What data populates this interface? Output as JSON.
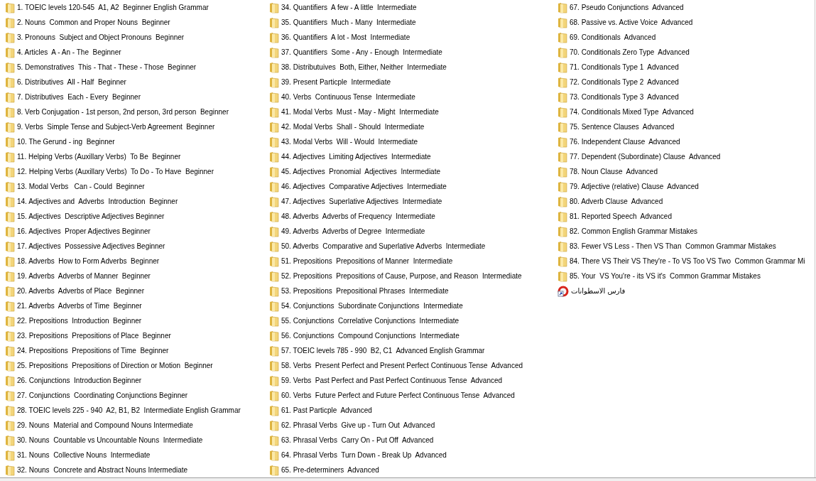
{
  "items": [
    {
      "kind": "folder",
      "label": "1. TOEIC levels 120-545  A1, A2  Beginner English Grammar"
    },
    {
      "kind": "folder",
      "label": "2. Nouns  Common and Proper Nouns  Beginner"
    },
    {
      "kind": "folder",
      "label": "3. Pronouns  Subject and Object Pronouns  Beginner"
    },
    {
      "kind": "folder",
      "label": "4. Articles  A - An - The  Beginner"
    },
    {
      "kind": "folder",
      "label": "5. Demonstratives  This - That - These - Those  Beginner"
    },
    {
      "kind": "folder",
      "label": "6. Distributives  All - Half  Beginner"
    },
    {
      "kind": "folder",
      "label": "7. Distributives  Each - Every  Beginner"
    },
    {
      "kind": "folder",
      "label": "8. Verb Conjugation - 1st person, 2nd person, 3rd person  Beginner"
    },
    {
      "kind": "folder",
      "label": "9. Verbs  Simple Tense and Subject-Verb Agreement  Beginner"
    },
    {
      "kind": "folder",
      "label": "10. The Gerund - ing  Beginner"
    },
    {
      "kind": "folder",
      "label": "11. Helping Verbs (Auxillary Verbs)  To Be  Beginner"
    },
    {
      "kind": "folder",
      "label": "12. Helping Verbs (Auxillary Verbs)  To Do - To Have  Beginner"
    },
    {
      "kind": "folder",
      "label": "13. Modal Verbs   Can - Could  Beginner"
    },
    {
      "kind": "folder",
      "label": "14. Adjectives and  Adverbs  Introduction  Beginner"
    },
    {
      "kind": "folder",
      "label": "15. Adjectives  Descriptive Adjectives Beginner"
    },
    {
      "kind": "folder",
      "label": "16. Adjectives  Proper Adjectives Beginner"
    },
    {
      "kind": "folder",
      "label": "17. Adjectives  Possessive Adjectives Beginner"
    },
    {
      "kind": "folder",
      "label": "18. Adverbs  How to Form Adverbs  Beginner"
    },
    {
      "kind": "folder",
      "label": "19. Adverbs  Adverbs of Manner  Beginner"
    },
    {
      "kind": "folder",
      "label": "20. Adverbs  Adverbs of Place  Beginner"
    },
    {
      "kind": "folder",
      "label": "21. Adverbs  Adverbs of Time  Beginner"
    },
    {
      "kind": "folder",
      "label": "22. Prepositions  Introduction  Beginner"
    },
    {
      "kind": "folder",
      "label": "23. Prepositions  Prepositions of Place  Beginner"
    },
    {
      "kind": "folder",
      "label": "24. Prepositions  Prepositions of Time  Beginner"
    },
    {
      "kind": "folder",
      "label": "25. Prepositions  Prepositions of Direction or Motion  Beginner"
    },
    {
      "kind": "folder",
      "label": "26. Conjunctions  Introduction Beginner"
    },
    {
      "kind": "folder",
      "label": "27. Conjunctions  Coordinating Conjunctions Beginner"
    },
    {
      "kind": "folder",
      "label": "28. TOEIC levels 225 - 940  A2, B1, B2  Intermediate English Grammar"
    },
    {
      "kind": "folder",
      "label": "29. Nouns  Material and Compound Nouns Intermediate"
    },
    {
      "kind": "folder",
      "label": "30. Nouns  Countable vs Uncountable Nouns  Intermediate"
    },
    {
      "kind": "folder",
      "label": "31. Nouns  Collective Nouns  Intermediate"
    },
    {
      "kind": "folder",
      "label": "32. Nouns  Concrete and Abstract Nouns Intermediate"
    },
    {
      "kind": "folder",
      "label": "34. Quantifiers  A few - A little  Intermediate"
    },
    {
      "kind": "folder",
      "label": "35. Quantifiers  Much - Many  Intermediate"
    },
    {
      "kind": "folder",
      "label": "36. Quantifiers  A lot - Most  Intermediate"
    },
    {
      "kind": "folder",
      "label": "37. Quantifiers  Some - Any - Enough  Intermediate"
    },
    {
      "kind": "folder",
      "label": "38. Distributuives  Both, Either, Neither  Intermediate"
    },
    {
      "kind": "folder",
      "label": "39. Present Particple  Intermediate"
    },
    {
      "kind": "folder",
      "label": "40. Verbs  Continuous Tense  Intermediate"
    },
    {
      "kind": "folder",
      "label": "41. Modal Verbs  Must - May - Might  Intermediate"
    },
    {
      "kind": "folder",
      "label": "42. Modal Verbs  Shall - Should  Intermediate"
    },
    {
      "kind": "folder",
      "label": "43. Modal Verbs  Will - Would  Intermediate"
    },
    {
      "kind": "folder",
      "label": "44. Adjectives  Limiting Adjectives  Intermediate"
    },
    {
      "kind": "folder",
      "label": "45. Adjectives  Pronomial  Adjectives  Intermediate"
    },
    {
      "kind": "folder",
      "label": "46. Adjectives  Comparative Adjectives  Intermediate"
    },
    {
      "kind": "folder",
      "label": "47. Adjectives  Superlative Adjectives  Intermediate"
    },
    {
      "kind": "folder",
      "label": "48. Adverbs  Adverbs of Frequency  Intermediate"
    },
    {
      "kind": "folder",
      "label": "49. Adverbs  Adverbs of Degree  Intermediate"
    },
    {
      "kind": "folder",
      "label": "50. Adverbs  Comparative and Superlative Adverbs  Intermediate"
    },
    {
      "kind": "folder",
      "label": "51. Prepositions  Prepositions of Manner  Intermediate"
    },
    {
      "kind": "folder",
      "label": "52. Prepositions  Prepositions of Cause, Purpose, and Reason  Intermediate"
    },
    {
      "kind": "folder",
      "label": "53. Prepositions  Prepositional Phrases  Intermediate"
    },
    {
      "kind": "folder",
      "label": "54. Conjunctions  Subordinate Conjunctions  Intermediate"
    },
    {
      "kind": "folder",
      "label": "55. Conjunctions  Correlative Conjunctions  Intermediate"
    },
    {
      "kind": "folder",
      "label": "56. Conjunctions  Compound Conjunctions  Intermediate"
    },
    {
      "kind": "folder",
      "label": "57. TOEIC levels 785 - 990  B2, C1  Advanced English Grammar"
    },
    {
      "kind": "folder",
      "label": "58. Verbs  Present Perfect and Present Perfect Continuous Tense  Advanced"
    },
    {
      "kind": "folder",
      "label": "59. Verbs  Past Perfect and Past Perfect Continuous Tense  Advanced"
    },
    {
      "kind": "folder",
      "label": "60. Verbs  Future Perfect and Future Perfect Continuous Tense  Advanced"
    },
    {
      "kind": "folder",
      "label": "61. Past Particple  Advanced"
    },
    {
      "kind": "folder",
      "label": "62. Phrasal Verbs  Give up - Turn Out  Advanced"
    },
    {
      "kind": "folder",
      "label": "63. Phrasal Verbs  Carry On - Put Off  Advanced"
    },
    {
      "kind": "folder",
      "label": "64. Phrasal Verbs  Turn Down - Break Up  Advanced"
    },
    {
      "kind": "folder",
      "label": "65. Pre-determiners  Advanced"
    },
    {
      "kind": "folder",
      "label": "67. Pseudo Conjunctions  Advanced"
    },
    {
      "kind": "folder",
      "label": "68. Passive vs. Active Voice  Advanced"
    },
    {
      "kind": "folder",
      "label": "69. Conditionals  Advanced"
    },
    {
      "kind": "folder",
      "label": "70. Conditionals Zero Type  Advanced"
    },
    {
      "kind": "folder",
      "label": "71. Conditionals Type 1  Advanced"
    },
    {
      "kind": "folder",
      "label": "72. Conditionals Type 2  Advanced"
    },
    {
      "kind": "folder",
      "label": "73. Conditionals Type 3  Advanced"
    },
    {
      "kind": "folder",
      "label": "74. Conditionals Mixed Type  Advanced"
    },
    {
      "kind": "folder",
      "label": "75. Sentence Clauses  Advanced"
    },
    {
      "kind": "folder",
      "label": "76. Independent Clause  Advanced"
    },
    {
      "kind": "folder",
      "label": "77. Dependent (Subordinate) Clause  Advanced"
    },
    {
      "kind": "folder",
      "label": "78. Noun Clause  Advanced"
    },
    {
      "kind": "folder",
      "label": "79. Adjective (relative) Clause  Advanced"
    },
    {
      "kind": "folder",
      "label": "80. Adverb Clause  Advanced"
    },
    {
      "kind": "folder",
      "label": "81. Reported Speech  Advanced"
    },
    {
      "kind": "folder",
      "label": "82. Common English Grammar Mistakes"
    },
    {
      "kind": "folder",
      "label": "83. Fewer VS Less - Then VS Than  Common Grammar Mistakes"
    },
    {
      "kind": "folder",
      "label": "84. There VS Their VS They're - To VS Too VS Two  Common Grammar Mi"
    },
    {
      "kind": "folder",
      "label": "85. Your  VS You're - its VS it's  Common Grammar Mistakes"
    },
    {
      "kind": "shortcut",
      "label": "فارس الاسطوانات"
    }
  ]
}
